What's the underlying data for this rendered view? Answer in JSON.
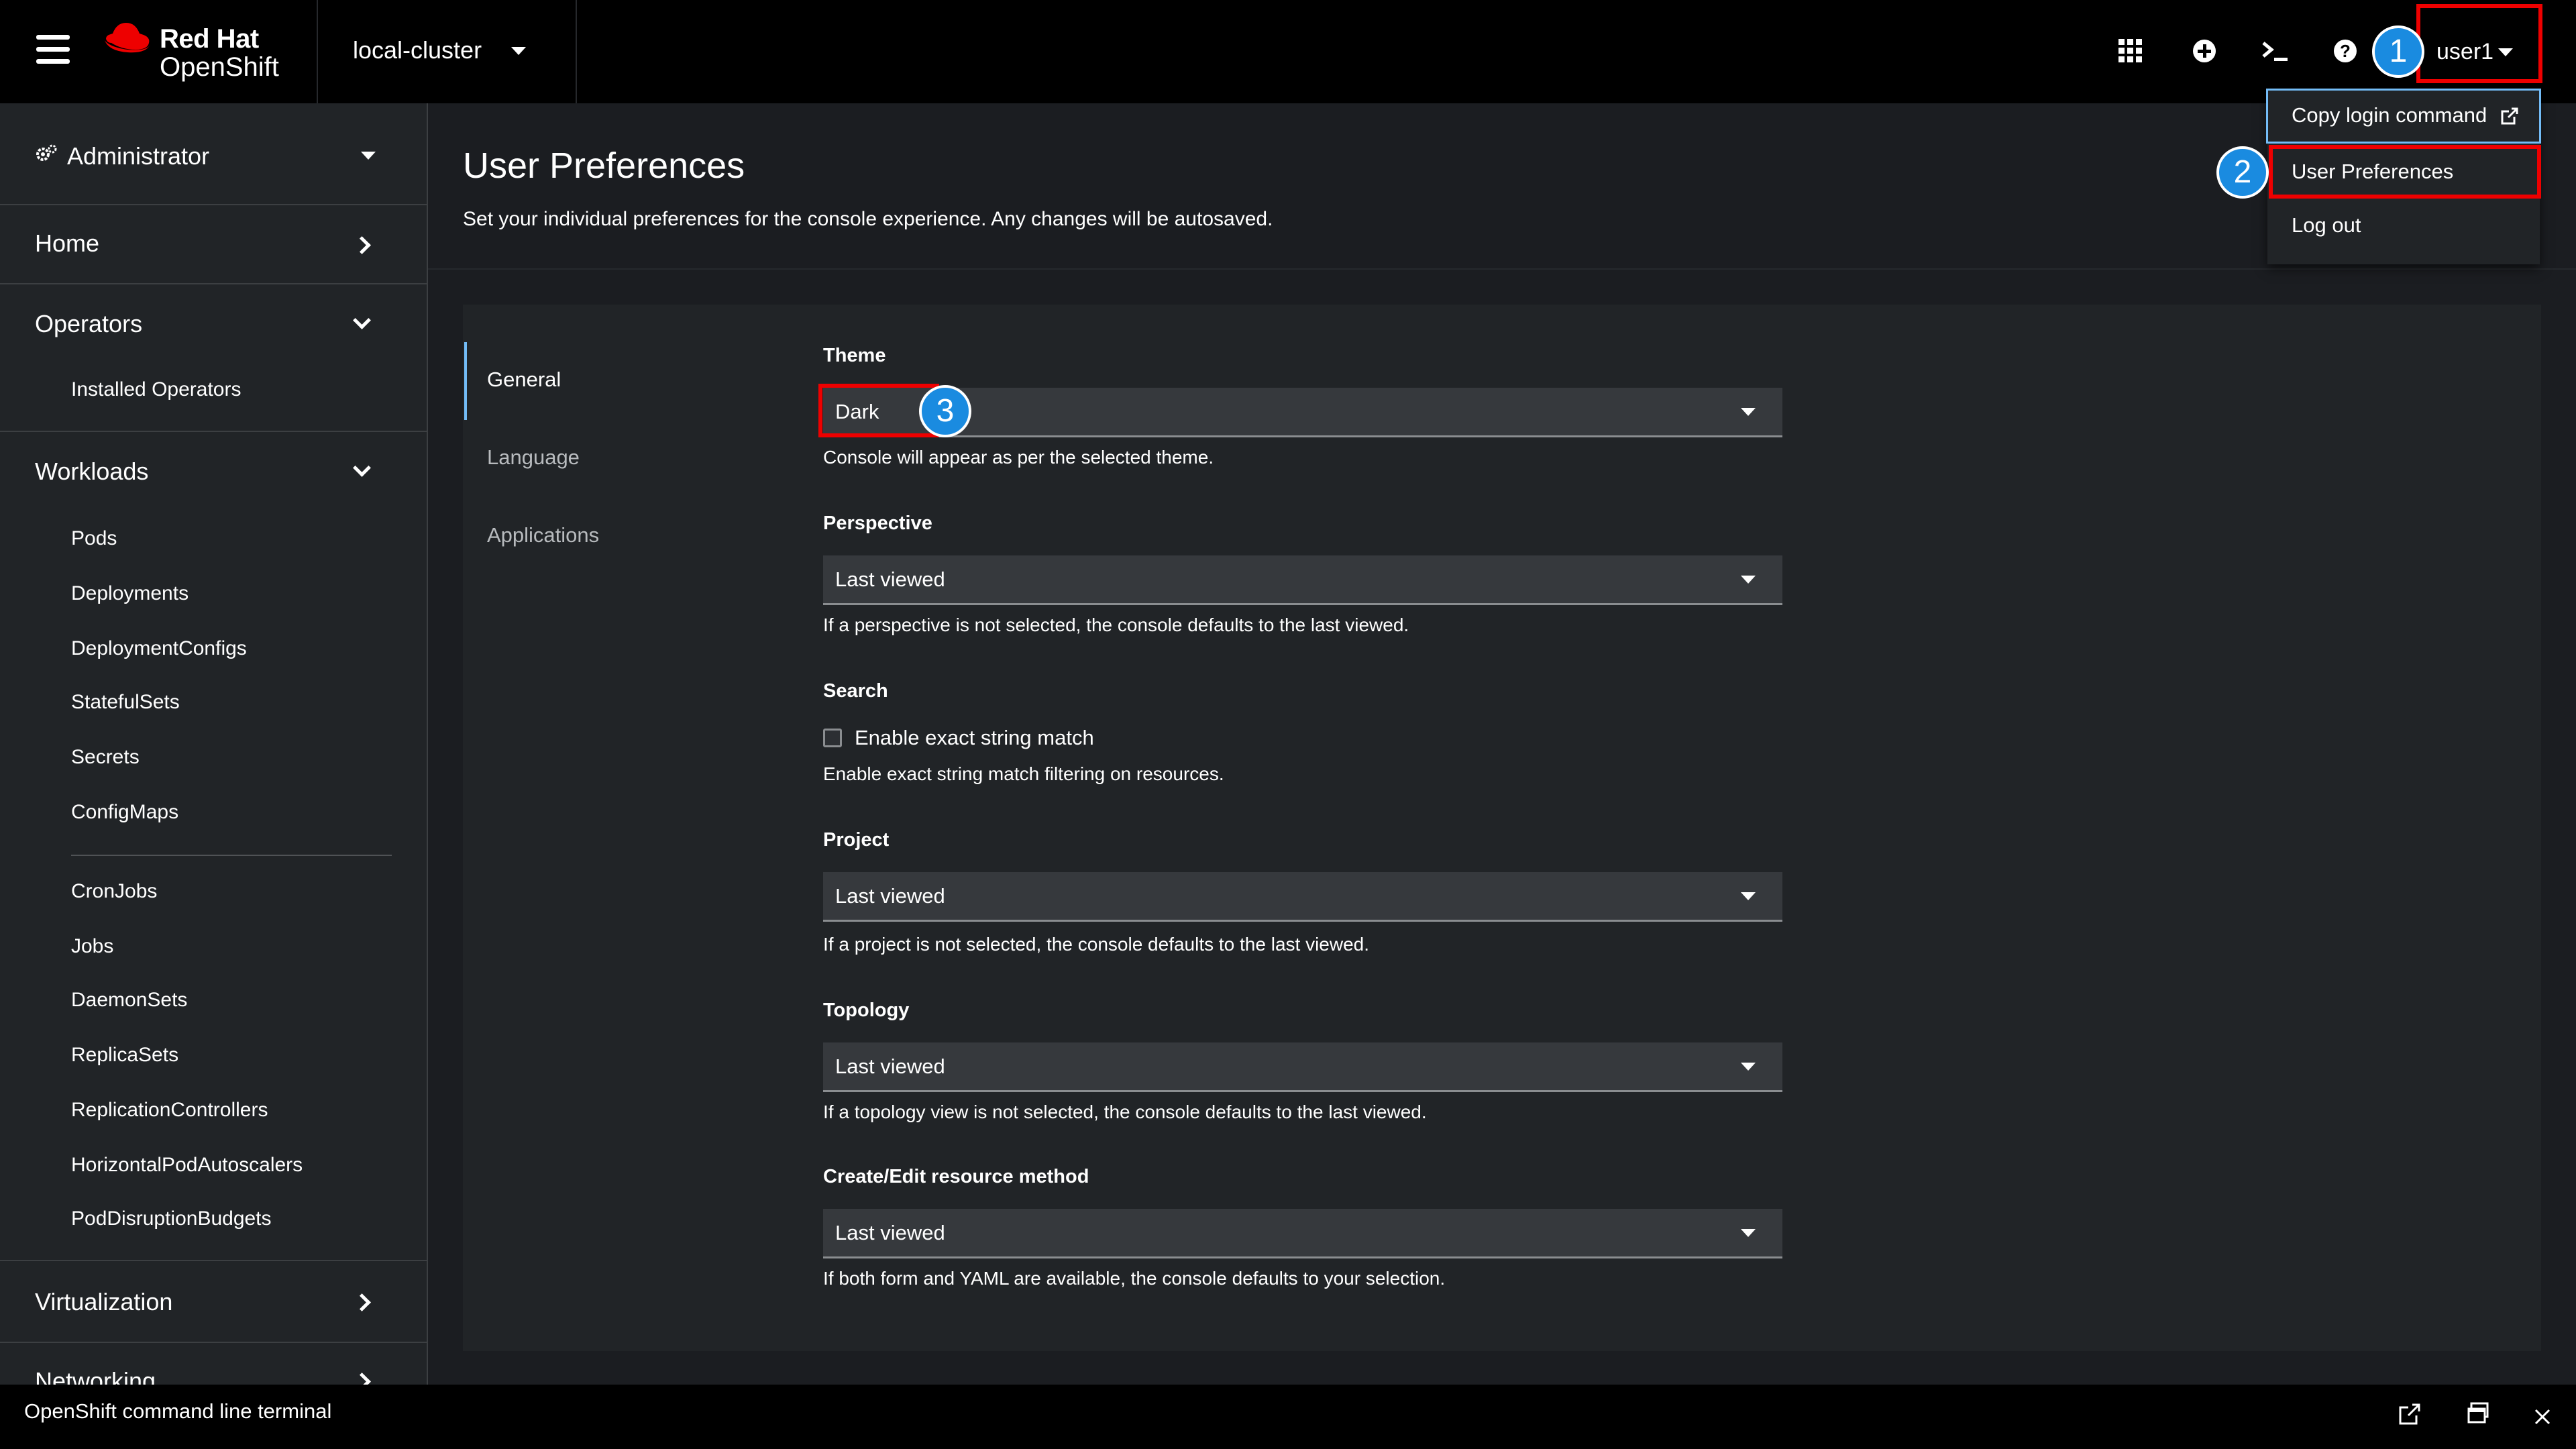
{
  "masthead": {
    "brand_line1": "Red Hat",
    "brand_line2": "OpenShift",
    "cluster": "local-cluster",
    "user": "user1",
    "icons": [
      "grid-icon",
      "plus-circle-icon",
      "terminal-icon",
      "help-icon"
    ]
  },
  "annotations": {
    "badge1": "1",
    "badge2": "2",
    "badge3": "3"
  },
  "user_menu": {
    "items": [
      "Copy login command",
      "User Preferences",
      "Log out"
    ]
  },
  "sidebar": {
    "perspective": "Administrator",
    "home": "Home",
    "operators": {
      "label": "Operators",
      "items": [
        "Installed Operators"
      ]
    },
    "workloads": {
      "label": "Workloads",
      "items": [
        "Pods",
        "Deployments",
        "DeploymentConfigs",
        "StatefulSets",
        "Secrets",
        "ConfigMaps",
        "CronJobs",
        "Jobs",
        "DaemonSets",
        "ReplicaSets",
        "ReplicationControllers",
        "HorizontalPodAutoscalers",
        "PodDisruptionBudgets"
      ]
    },
    "virtualization": "Virtualization",
    "networking": "Networking"
  },
  "page": {
    "title": "User Preferences",
    "description": "Set your individual preferences for the console experience. Any changes will be autosaved.",
    "tabs": [
      "General",
      "Language",
      "Applications"
    ]
  },
  "settings": {
    "theme": {
      "label": "Theme",
      "value": "Dark",
      "helper": "Console will appear as per the selected theme."
    },
    "perspective": {
      "label": "Perspective",
      "value": "Last viewed",
      "helper": "If a perspective is not selected, the console defaults to the last viewed."
    },
    "search": {
      "label": "Search",
      "checkbox": "Enable exact string match",
      "checked": false,
      "helper": "Enable exact string match filtering on resources."
    },
    "project": {
      "label": "Project",
      "value": "Last viewed",
      "helper": "If a project is not selected, the console defaults to the last viewed."
    },
    "topology": {
      "label": "Topology",
      "value": "Last viewed",
      "helper": "If a topology view is not selected, the console defaults to the last viewed."
    },
    "resource_method": {
      "label": "Create/Edit resource method",
      "value": "Last viewed",
      "helper": "If both form and YAML are available, the console defaults to your selection."
    }
  },
  "terminal": {
    "title": "OpenShift command line terminal"
  },
  "colors": {
    "accent": "#73bcf7",
    "annotation": "#1a8be0",
    "highlight": "#ee0000",
    "brand": "#ee0000"
  }
}
